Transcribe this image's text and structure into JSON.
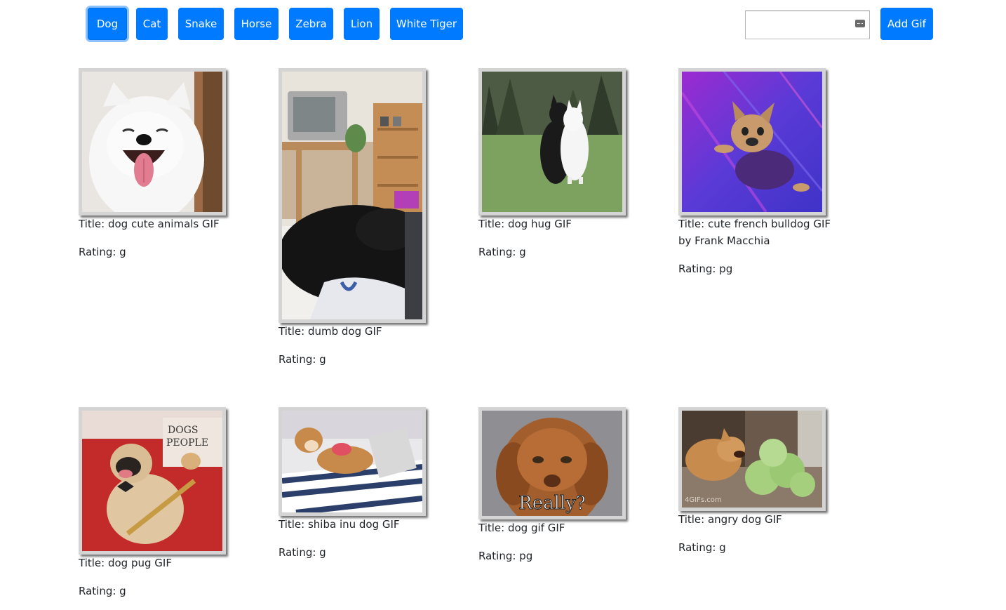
{
  "topics": {
    "buttons": [
      "Dog",
      "Cat",
      "Snake",
      "Horse",
      "Zebra",
      "Lion",
      "White Tiger"
    ],
    "active": "Dog"
  },
  "search": {
    "value": "",
    "add_label": "Add Gif"
  },
  "gifs": [
    {
      "image": "white samoyed dog smiling",
      "title": "Title: dog cute animals GIF",
      "rating": "Rating: g"
    },
    {
      "image": "black dog lying in bedroom near TV",
      "title": "Title: dumb dog GIF",
      "rating": "Rating: g"
    },
    {
      "image": "two border collies hugging on grass",
      "title": "Title: dog hug GIF",
      "rating": "Rating: g"
    },
    {
      "image": "french bulldog flying on purple background",
      "title": "Title: cute french bulldog GIF by Frank Macchia",
      "rating": "Rating: pg"
    },
    {
      "image": "pug with bow tie on red blanket",
      "title": "Title: dog pug GIF",
      "rating": "Rating: g"
    },
    {
      "image": "shiba inu lying with laptop",
      "title": "Title: shiba inu dog GIF",
      "rating": "Rating: g"
    },
    {
      "image": "brown puppy with skeptical face",
      "overlay_text": "Really?",
      "title": "Title: dog gif GIF",
      "rating": "Rating: pg"
    },
    {
      "image": "corgi barking at cabbages",
      "overlay_text": "4GIFs.com",
      "title": "Title: angry dog GIF",
      "rating": "Rating: g"
    }
  ],
  "colors": {
    "primary": "#007bff",
    "frame": "#d4d4d4"
  }
}
